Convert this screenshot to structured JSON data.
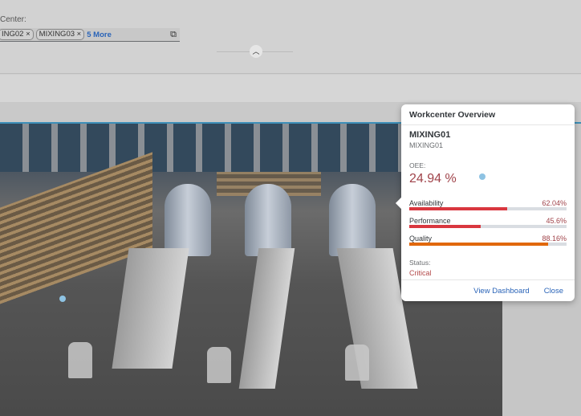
{
  "filter": {
    "label": "Center:",
    "tokens": [
      "ING02",
      "MIXING03"
    ],
    "more": "5 More",
    "value_help_icon": "value-help-icon"
  },
  "collapse_icon": "chevron-up-icon",
  "popover": {
    "title": "Workcenter Overview",
    "name": "MIXING01",
    "id": "MIXING01",
    "oee_label": "OEE:",
    "oee_value": "24.94 %",
    "metrics": [
      {
        "label": "Availability",
        "value": "62.04%",
        "percent": 62.04,
        "color": "#d9373f"
      },
      {
        "label": "Performance",
        "value": "45.6%",
        "percent": 45.6,
        "color": "#d9373f"
      },
      {
        "label": "Quality",
        "value": "88.16%",
        "percent": 88.16,
        "color": "#e1680c"
      }
    ],
    "status_label": "Status:",
    "status_value": "Critical",
    "view_dashboard": "View Dashboard",
    "close": "Close"
  },
  "colors": {
    "accent": "#2a64b8",
    "critical": "#b44a4a",
    "scene_border": "#3d8fb8"
  }
}
